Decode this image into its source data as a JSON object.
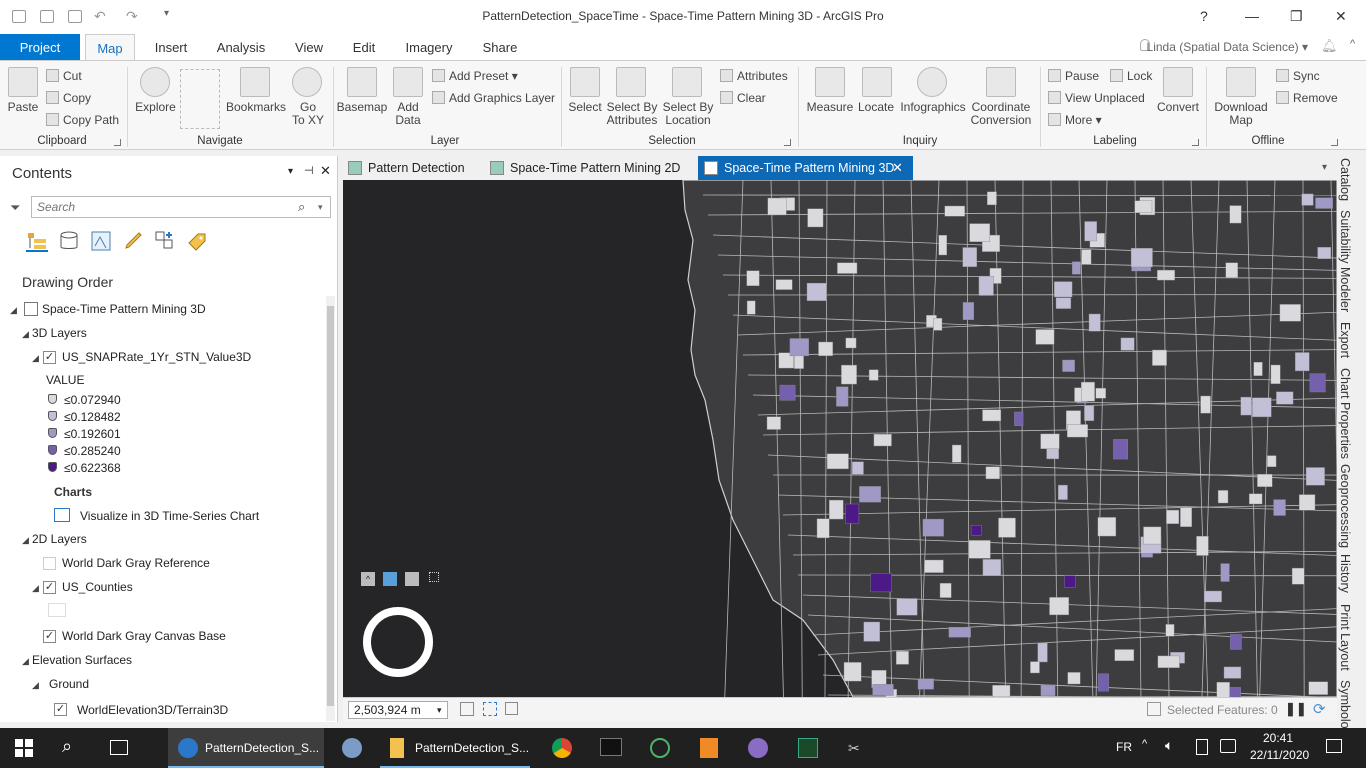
{
  "window": {
    "title": "PatternDetection_SpaceTime - Space-Time Pattern Mining 3D - ArcGIS Pro",
    "help": "?",
    "minimize": "—",
    "restore": "❐",
    "close": "✕"
  },
  "ribbon_tabs": [
    "Project",
    "Map",
    "Insert",
    "Analysis",
    "View",
    "Edit",
    "Imagery",
    "Share"
  ],
  "user": "Linda (Spatial Data Science) ▾",
  "ribbon": {
    "clipboard": {
      "paste": "Paste",
      "cut": "Cut",
      "copy": "Copy",
      "copy_path": "Copy Path",
      "group": "Clipboard"
    },
    "navigate": {
      "explore": "Explore",
      "bookmarks": "Bookmarks",
      "goto_1": "Go",
      "goto_2": "To XY",
      "group": "Navigate"
    },
    "layer": {
      "basemap": "Basemap",
      "add_1": "Add",
      "add_2": "Data",
      "add_preset": "Add Preset",
      "add_graphics": "Add Graphics Layer",
      "group": "Layer"
    },
    "selection": {
      "select": "Select",
      "by_attr_1": "Select By",
      "by_attr_2": "Attributes",
      "by_loc_1": "Select By",
      "by_loc_2": "Location",
      "attributes": "Attributes",
      "clear": "Clear",
      "group": "Selection"
    },
    "inquiry": {
      "measure": "Measure",
      "locate": "Locate",
      "infographics": "Infographics",
      "coord_1": "Coordinate",
      "coord_2": "Conversion",
      "group": "Inquiry"
    },
    "labeling": {
      "pause": "Pause",
      "lock": "Lock",
      "view_unplaced": "View Unplaced",
      "more": "More",
      "convert": "Convert",
      "group": "Labeling"
    },
    "offline": {
      "download_1": "Download",
      "download_2": "Map",
      "sync": "Sync",
      "remove": "Remove",
      "group": "Offline"
    }
  },
  "contents": {
    "title": "Contents",
    "search_placeholder": "Search",
    "drawing_order": "Drawing Order",
    "map_name": "Space-Time Pattern Mining 3D",
    "layers_3d": "3D Layers",
    "layer_3d": "US_SNAPRate_1Yr_STN_Value3D",
    "value_label": "VALUE",
    "legend": [
      {
        "label": "≤0.072940",
        "color": "#d9d9de"
      },
      {
        "label": "≤0.128482",
        "color": "#c2c0d6"
      },
      {
        "label": "≤0.192601",
        "color": "#9f99c6"
      },
      {
        "label": "≤0.285240",
        "color": "#7560ad"
      },
      {
        "label": "≤0.622368",
        "color": "#4b1a86"
      }
    ],
    "charts": "Charts",
    "chart_item": "Visualize in 3D Time-Series Chart",
    "layers_2d": "2D Layers",
    "ref_layer": "World Dark Gray Reference",
    "counties": "US_Counties",
    "base_layer": "World Dark Gray Canvas Base",
    "elevation": "Elevation Surfaces",
    "ground": "Ground",
    "terrain": "WorldElevation3D/Terrain3D"
  },
  "view_tabs": [
    "Pattern Detection",
    "Space-Time Pattern Mining 2D",
    "Space-Time Pattern Mining 3D"
  ],
  "map_footer": {
    "scale": "2,503,924 m",
    "selected": "Selected Features: 0"
  },
  "right_dock": [
    "Catalog",
    "Suitability Modeler",
    "Export",
    "Chart Properties",
    "Geoprocessing",
    "History",
    "Print Layout",
    "Symbology"
  ],
  "taskbar": {
    "app1": "PatternDetection_S...",
    "app2": "PatternDetection_S...",
    "lang": "FR",
    "time": "20:41",
    "date": "22/11/2020"
  },
  "colors": {
    "accent": "#0077d1",
    "map_bg": "#252527",
    "land": "#3d3d40"
  }
}
